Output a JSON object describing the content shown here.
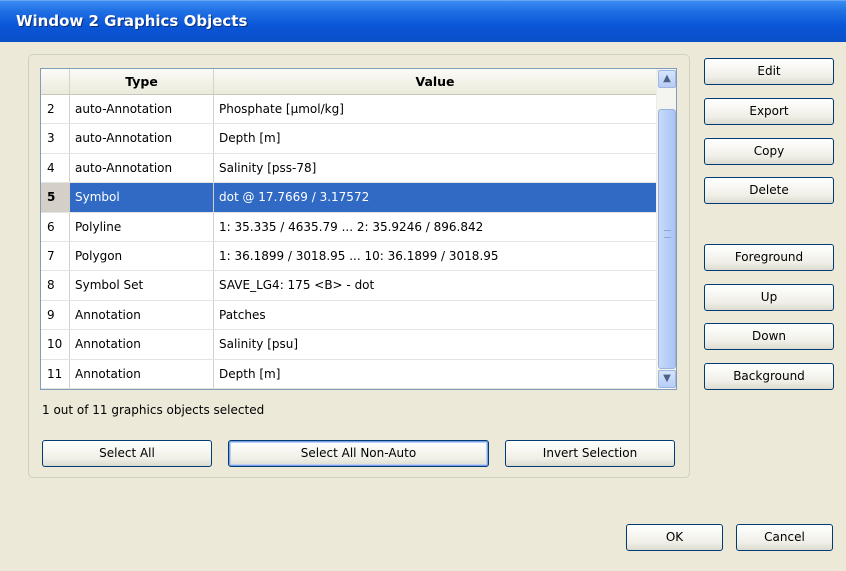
{
  "window": {
    "title": "Window 2 Graphics Objects"
  },
  "table": {
    "columns": [
      "Type",
      "Value"
    ],
    "rows": [
      {
        "num": "2",
        "type": "auto-Annotation",
        "value": "Phosphate [µmol/kg]"
      },
      {
        "num": "3",
        "type": "auto-Annotation",
        "value": "Depth [m]"
      },
      {
        "num": "4",
        "type": "auto-Annotation",
        "value": "Salinity [pss-78]"
      },
      {
        "num": "5",
        "type": "Symbol",
        "value": "dot @ 17.7669 / 3.17572",
        "selected": true
      },
      {
        "num": "6",
        "type": "Polyline",
        "value": "1: 35.335 / 4635.79 ... 2: 35.9246 / 896.842"
      },
      {
        "num": "7",
        "type": "Polygon",
        "value": "1: 36.1899 / 3018.95 ... 10: 36.1899 / 3018.95"
      },
      {
        "num": "8",
        "type": "Symbol Set",
        "value": "SAVE_LG4: 175 <B> - dot"
      },
      {
        "num": "9",
        "type": "Annotation",
        "value": "Patches"
      },
      {
        "num": "10",
        "type": "Annotation",
        "value": "Salinity [psu]"
      },
      {
        "num": "11",
        "type": "Annotation",
        "value": "Depth [m]"
      }
    ]
  },
  "status": "1 out of 11 graphics objects selected",
  "buttons": {
    "edit": "Edit",
    "export": "Export",
    "copy": "Copy",
    "delete": "Delete",
    "foreground": "Foreground",
    "up": "Up",
    "down": "Down",
    "background": "Background",
    "select_all": "Select All",
    "select_all_non_auto": "Select All Non-Auto",
    "invert_selection": "Invert Selection",
    "ok": "OK",
    "cancel": "Cancel"
  },
  "icons": {
    "scroll_up": "scroll-up-arrow-icon",
    "scroll_down": "scroll-down-arrow-icon"
  },
  "colors": {
    "selection": "#316ac5",
    "title_bar": "#0a56d8"
  }
}
